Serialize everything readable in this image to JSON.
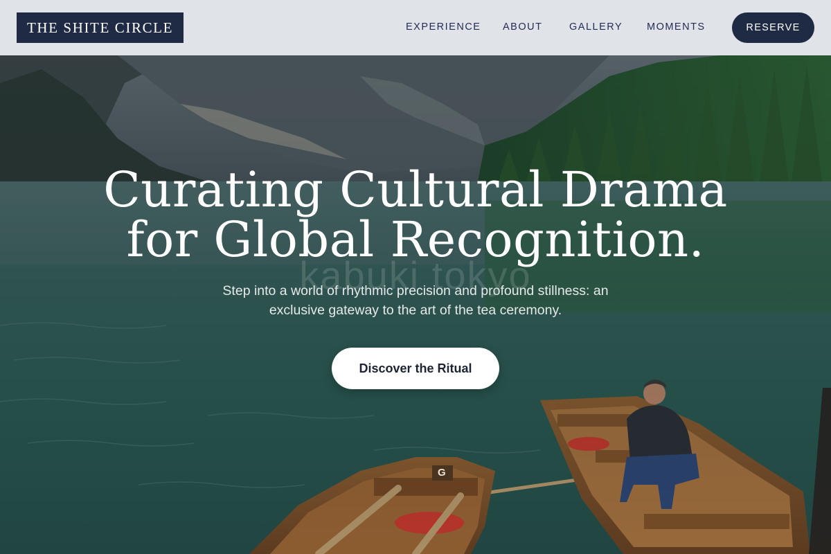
{
  "header": {
    "brand": "THE SHITE CIRCLE",
    "nav": [
      {
        "label": "EXPERIENCE"
      },
      {
        "label": "ABOUT"
      },
      {
        "label": "GALLERY"
      },
      {
        "label": "MOMENTS"
      }
    ],
    "reserve_label": "RESERVE"
  },
  "hero": {
    "watermark": "kabuki tokyo",
    "headline_line1": "Curating Cultural Drama",
    "headline_line2": "for Global Recognition.",
    "subtitle": "Step into a world of rhythmic precision and profound stillness: an exclusive gateway to the art of the tea ceremony.",
    "cta_label": "Discover the Ritual",
    "boat_tag": "G"
  },
  "colors": {
    "header_bg": "#e8eaee",
    "brand_navy": "#1f2a44",
    "nav_text": "#232c57",
    "cta_bg": "#ffffff",
    "lake_green": "#2f6a5e"
  }
}
